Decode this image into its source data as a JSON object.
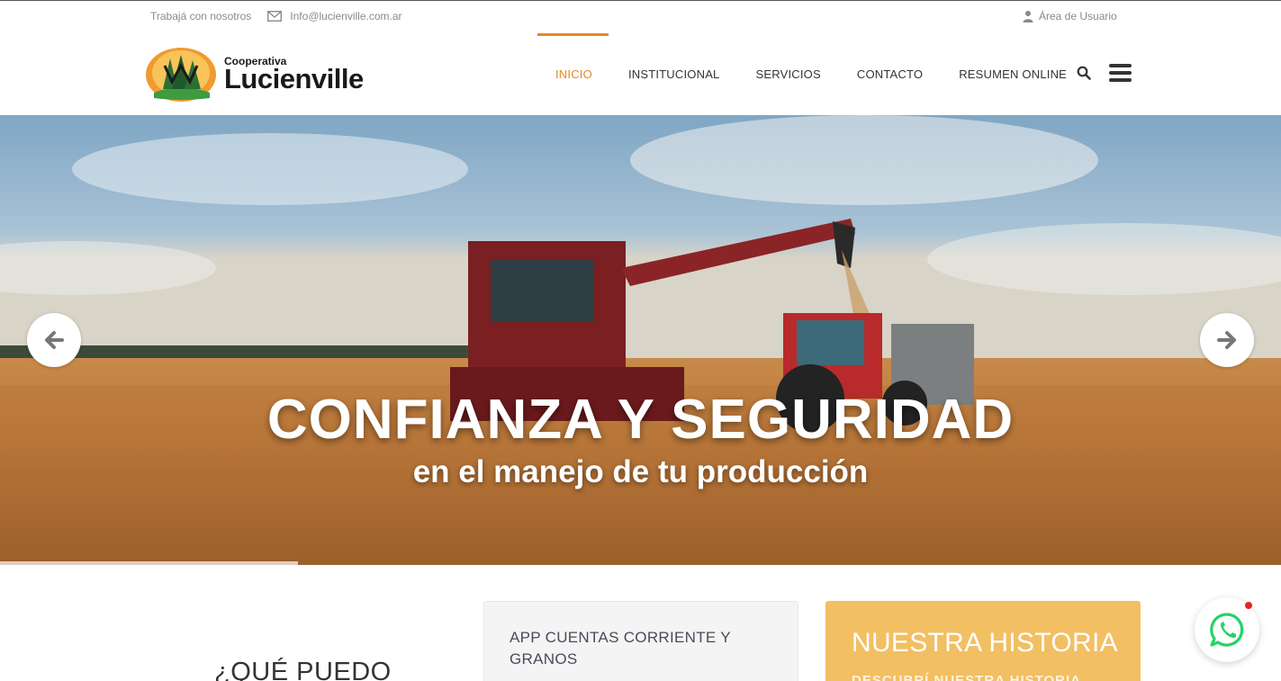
{
  "topbar": {
    "work_with_us": "Trabajá con nosotros",
    "email": "Info@lucienville.com.ar",
    "user_area": "Área de Usuario"
  },
  "logo": {
    "small": "Cooperativa",
    "large": "Lucienville"
  },
  "nav": {
    "items": [
      {
        "label": "INICIO",
        "active": true
      },
      {
        "label": "INSTITUCIONAL",
        "active": false
      },
      {
        "label": "SERVICIOS",
        "active": false
      },
      {
        "label": "CONTACTO",
        "active": false
      },
      {
        "label": "RESUMEN ONLINE",
        "active": false
      }
    ],
    "icons": [
      "search-icon",
      "hamburger-menu-icon"
    ]
  },
  "hero": {
    "title": "CONFIANZA Y SEGURIDAD",
    "subtitle": "en el manejo de tu producción",
    "prev_icon": "arrow-left-icon",
    "next_icon": "arrow-right-icon"
  },
  "section": {
    "question": "¿QUÉ PUEDO",
    "app_card": "APP CUENTAS CORRIENTE Y GRANOS",
    "history_card_title": "NUESTRA HISTORIA",
    "history_card_sub": "DESCUBRÍ NUESTRA HISTORIA"
  },
  "colors": {
    "accent": "#e2892a",
    "history_card": "#f2bf63",
    "whatsapp": "#25d366"
  }
}
